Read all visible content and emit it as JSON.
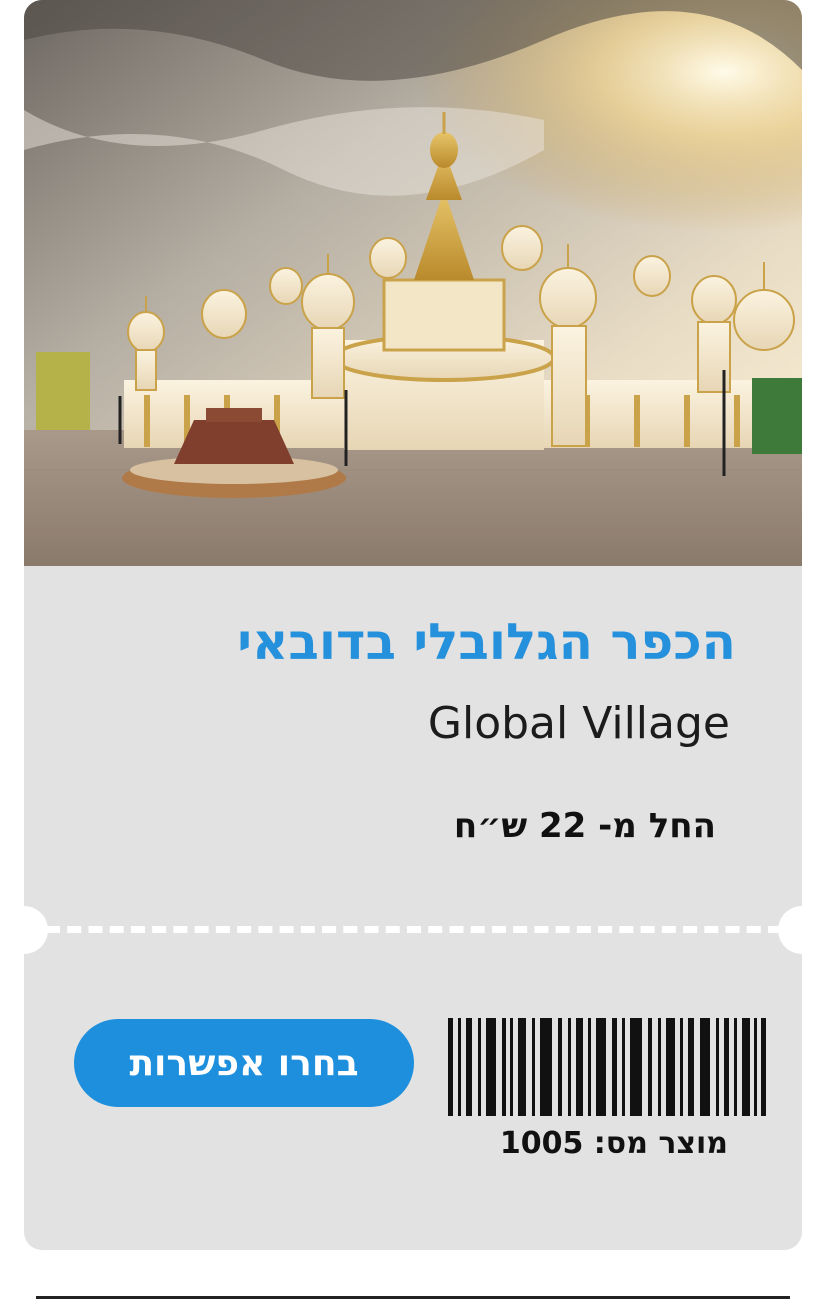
{
  "ticket": {
    "image_alt": "Global Village Dubai",
    "title_he": "הכפר הגלובלי בדובאי",
    "title_en": "Global Village",
    "price_text": "החל מ- 22 ש״ח",
    "cta_label": "בחרו אפשרות",
    "product_number": "מוצר מס: 1005"
  },
  "colors": {
    "accent": "#2590db",
    "button": "#1e8fdd",
    "card_bg": "#e2e2e2"
  },
  "icons": {
    "barcode": "barcode-icon"
  }
}
